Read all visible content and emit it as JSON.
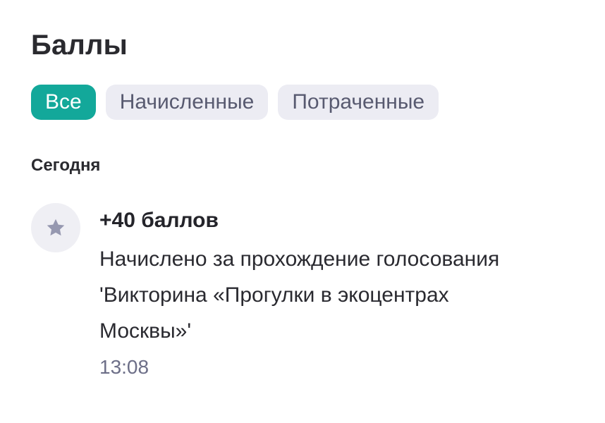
{
  "header": {
    "title": "Баллы"
  },
  "filters": {
    "tabs": [
      {
        "label": "Все",
        "active": true
      },
      {
        "label": "Начисленные",
        "active": false
      },
      {
        "label": "Потраченные",
        "active": false
      }
    ]
  },
  "history": {
    "section_label": "Сегодня",
    "transactions": [
      {
        "icon": "star-icon",
        "amount": "+40 баллов",
        "description": "Начислено за прохождение голосования\n'Викторина «Прогулки в экоцентрах\nМосквы»'",
        "time": "13:08"
      }
    ]
  },
  "colors": {
    "accent": "#13a89a",
    "chip_inactive_bg": "#ececf3",
    "icon_bg": "#efeff4",
    "icon_fg": "#9698b0",
    "muted_text": "#6d6f88"
  }
}
